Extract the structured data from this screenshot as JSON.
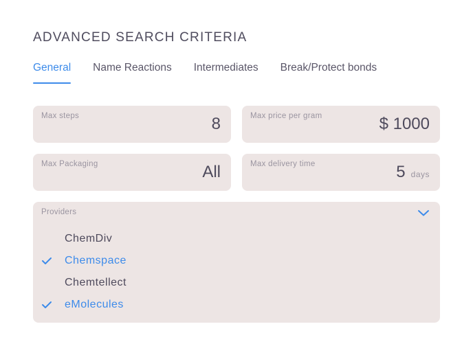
{
  "title": "ADVANCED SEARCH CRITERIA",
  "tabs": [
    {
      "label": "General",
      "active": true
    },
    {
      "label": "Name Reactions",
      "active": false
    },
    {
      "label": "Intermediates",
      "active": false
    },
    {
      "label": "Break/Protect bonds",
      "active": false
    }
  ],
  "fields": {
    "max_steps": {
      "label": "Max steps",
      "value": "8"
    },
    "max_price": {
      "label": "Max price per gram",
      "value": "$ 1000"
    },
    "max_packaging": {
      "label": "Max Packaging",
      "value": "All"
    },
    "max_delivery": {
      "label": "Max delivery time",
      "value": "5",
      "unit": "days"
    }
  },
  "providers": {
    "label": "Providers",
    "expand_icon": "chevron-down-icon",
    "items": [
      {
        "name": "ChemDiv",
        "selected": false
      },
      {
        "name": "Chemspace",
        "selected": true
      },
      {
        "name": "Chemtellect",
        "selected": false
      },
      {
        "name": "eMolecules",
        "selected": true
      }
    ]
  },
  "colors": {
    "accent": "#3d8bea",
    "field_bg": "#ede5e4",
    "text": "#4e4a5c",
    "muted": "#9a94a0"
  }
}
